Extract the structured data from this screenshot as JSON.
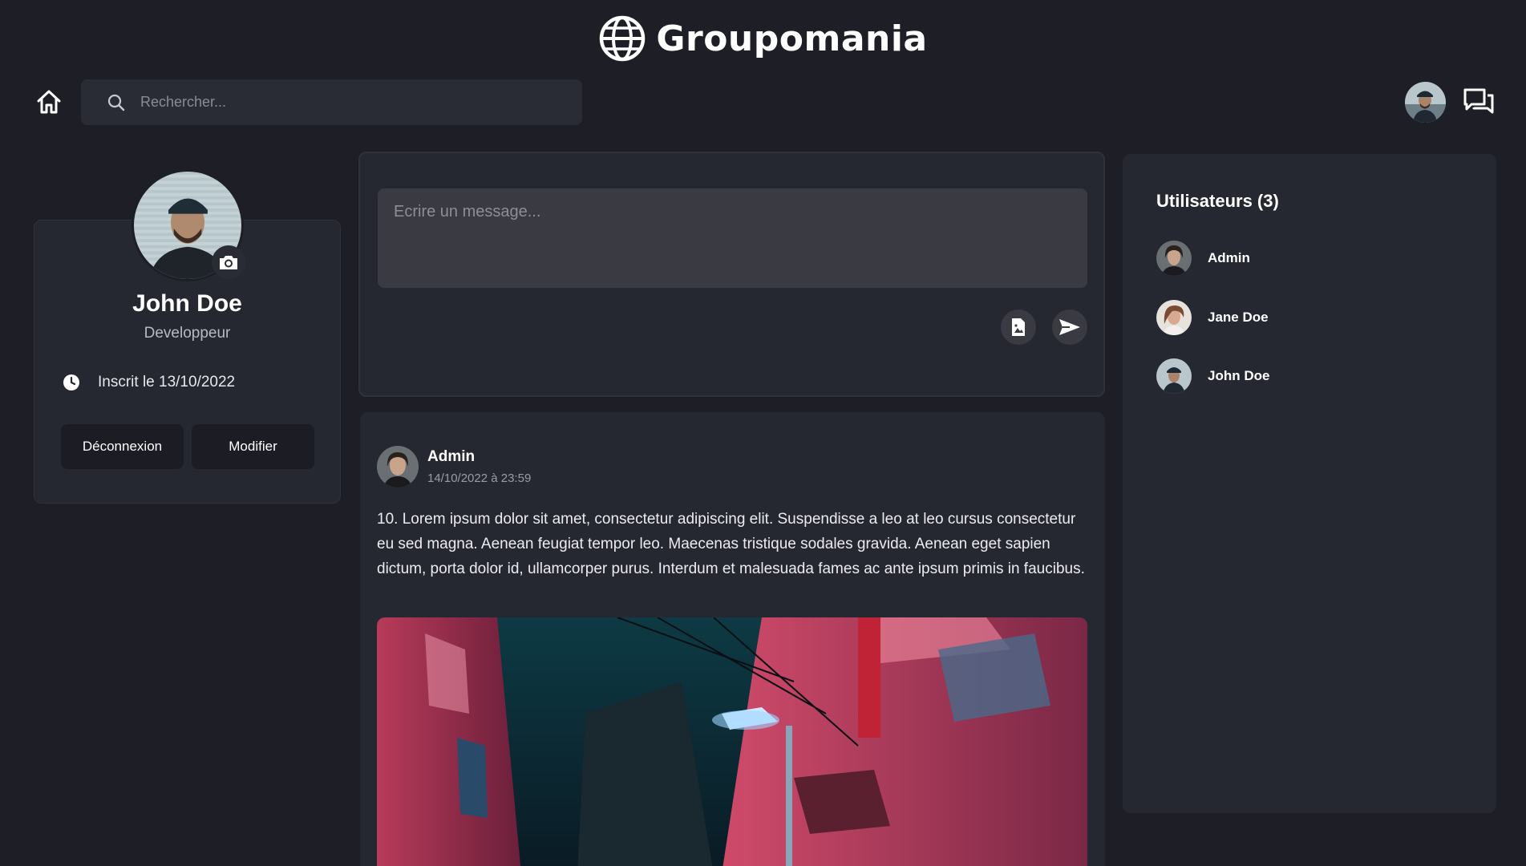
{
  "header": {
    "app_name": "Groupomania",
    "search": {
      "placeholder": "Rechercher...",
      "value": ""
    }
  },
  "profile": {
    "name": "John Doe",
    "role": "Developpeur",
    "joined": "Inscrit le 13/10/2022",
    "logout_label": "Déconnexion",
    "edit_label": "Modifier"
  },
  "composer": {
    "placeholder": "Ecrire un message...",
    "value": ""
  },
  "post": {
    "author": "Admin",
    "date": "14/10/2022 à 23:59",
    "text": "10. Lorem ipsum dolor sit amet, consectetur adipiscing elit. Suspendisse a leo at leo cursus consectetur eu sed magna. Aenean feugiat tempor leo. Maecenas tristique sodales gravida. Aenean eget sapien dictum, porta dolor id, ullamcorper purus. Interdum et malesuada fames ac ante ipsum primis in faucibus."
  },
  "users": {
    "title": "Utilisateurs (3)",
    "items": [
      {
        "name": "Admin"
      },
      {
        "name": "Jane Doe"
      },
      {
        "name": "John Doe"
      }
    ]
  },
  "icons": {
    "logo": "globe-icon",
    "home": "home-icon",
    "search": "search-icon",
    "chat": "chat-icon",
    "camera": "camera-icon",
    "clock": "clock-icon",
    "image": "image-icon",
    "send": "send-icon"
  },
  "colors": {
    "background": "#1e1f26",
    "card": "#262831",
    "input": "#3a3b42",
    "text": "#ffffff",
    "muted": "#9a9ca4"
  }
}
